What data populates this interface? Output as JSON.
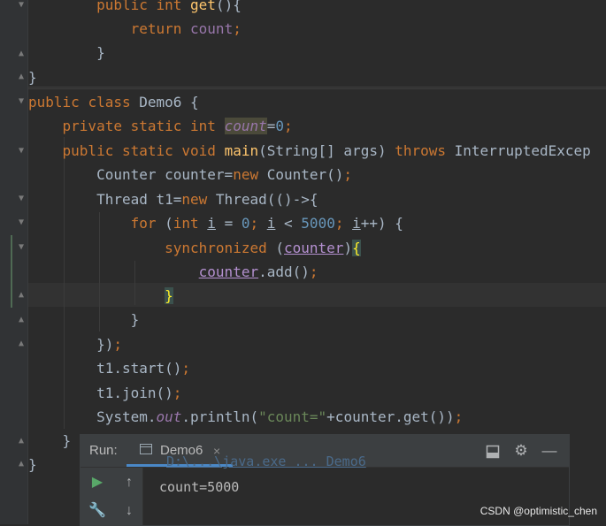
{
  "code": {
    "l1": {
      "kw1": "public ",
      "kw2": "int ",
      "fn": "get",
      "rest": "(){"
    },
    "l2": {
      "kw": "return ",
      "fld": "count",
      "semi": ";"
    },
    "l3": "}",
    "l4": "}",
    "l5": {
      "kw1": "public ",
      "kw2": "class ",
      "name": "Demo6 {"
    },
    "l6": {
      "kw": "private static int ",
      "fld": "count",
      "op": "=",
      "num": "0",
      "semi": ";"
    },
    "l7": {
      "kw": "public static void ",
      "fn": "main",
      "sig": "(String[] args) ",
      "kw2": "throws ",
      "exc": "InterruptedExcep"
    },
    "l8": {
      "a": "Counter counter=",
      "kw": "new ",
      "b": "Counter()",
      "semi": ";"
    },
    "l9": {
      "a": "Thread t1=",
      "kw": "new ",
      "b": "Thread(()->{"
    },
    "l10": {
      "kw1": "for ",
      "p1": "(",
      "kw2": "int ",
      "v1": "i",
      "p2": " = ",
      "n1": "0",
      "s1": "; ",
      "v2": "i",
      "p3": " < ",
      "n2": "5000",
      "s2": "; ",
      "v3": "i",
      "p4": "++) {"
    },
    "l11": {
      "kw": "synchronized ",
      "p1": "(",
      "v": "counter",
      "p2": ")",
      "brace": "{"
    },
    "l12": {
      "v": "counter",
      "rest": ".add()",
      "semi": ";"
    },
    "l13": "}",
    "l14": "}",
    "l15": {
      "a": "})",
      "semi": ";"
    },
    "l16": {
      "a": "t1.start()",
      "semi": ";"
    },
    "l17": {
      "a": "t1.join()",
      "semi": ";"
    },
    "l18": {
      "a": "System.",
      "fld": "out",
      "b": ".println(",
      "str": "\"count=\"",
      "c": "+counter.get())",
      "semi": ";"
    },
    "l19": "}",
    "l20": "}"
  },
  "run_panel": {
    "label": "Run:",
    "tab_label": "Demo6",
    "tab_close": "×",
    "icons": {
      "layout": "layout-icon",
      "settings": "gear-icon",
      "minimize": "minimize-icon",
      "rerun": "run-icon",
      "up": "arrow-up-icon",
      "wrench": "wrench-icon",
      "down": "arrow-down-icon"
    },
    "console_ghost": "D:\\...\\java.exe ... Demo6",
    "console_output": "count=5000"
  },
  "watermark": "CSDN @optimistic_chen",
  "colors": {
    "keyword": "#cc7832",
    "function": "#ffc66d",
    "number": "#6897bb",
    "string": "#6a8759",
    "field": "#9876aa",
    "text": "#a9b7c6",
    "background": "#2b2b2b",
    "accent": "#4a88c7"
  }
}
